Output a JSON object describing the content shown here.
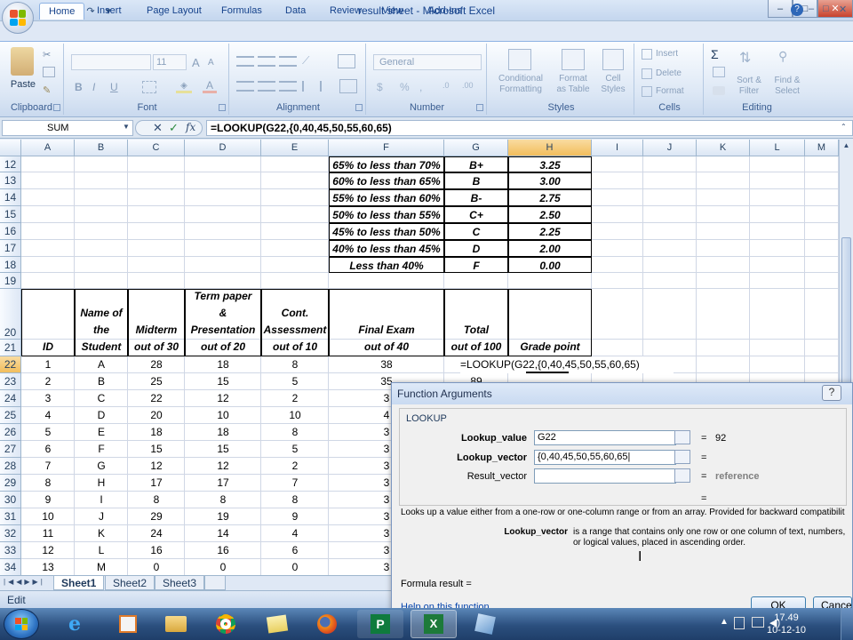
{
  "window": {
    "title": "result sheet - Microsoft Excel",
    "minimize_glyph": "–",
    "maximize_glyph": "□",
    "close_glyph": "✕"
  },
  "ribbon_tabs": [
    "Home",
    "Insert",
    "Page Layout",
    "Formulas",
    "Data",
    "Review",
    "View",
    "Add-Ins"
  ],
  "ribbon_extra": {
    "minimize": "–",
    "restore": "□",
    "close": "✕"
  },
  "ribbon": {
    "clipboard": {
      "label": "Clipboard",
      "paste": "Paste"
    },
    "font": {
      "label": "Font",
      "font_size": "11",
      "grow": "A",
      "shrink": "A",
      "bold": "B",
      "italic": "I",
      "underline": "U"
    },
    "alignment": {
      "label": "Alignment"
    },
    "number": {
      "label": "Number",
      "format": "General"
    },
    "styles": {
      "label": "Styles",
      "conditional": "Conditional\nFormatting",
      "table": "Format\nas Table",
      "cell": "Cell\nStyles"
    },
    "cells": {
      "label": "Cells",
      "insert": "Insert",
      "delete": "Delete",
      "format": "Format"
    },
    "editing": {
      "label": "Editing",
      "sum": "Σ",
      "sort": "Sort &\nFilter",
      "find": "Find &\nSelect"
    }
  },
  "formula_bar": {
    "name_box": "SUM",
    "fx": "fx",
    "cancel": "✕",
    "enter": "✓",
    "formula": "=LOOKUP(G22,{0,40,45,50,55,60,65)"
  },
  "columns": [
    "A",
    "B",
    "C",
    "D",
    "E",
    "F",
    "G",
    "H",
    "I",
    "J",
    "K",
    "L",
    "M"
  ],
  "selected_column": "H",
  "rows": [
    "12",
    "13",
    "14",
    "15",
    "16",
    "17",
    "18",
    "19",
    "20",
    "21",
    "22",
    "23",
    "24",
    "25",
    "26",
    "27",
    "28",
    "29",
    "30",
    "31",
    "32",
    "33",
    "34"
  ],
  "selected_row": "22",
  "grade_table": [
    {
      "range": "65% to less than 70%",
      "grade": "B+",
      "point": "3.25"
    },
    {
      "range": "60% to less than 65%",
      "grade": "B",
      "point": "3.00"
    },
    {
      "range": "55% to less than 60%",
      "grade": "B-",
      "point": "2.75"
    },
    {
      "range": "50% to less than 55%",
      "grade": "C+",
      "point": "2.50"
    },
    {
      "range": "45% to less than 50%",
      "grade": "C",
      "point": "2.25"
    },
    {
      "range": "40% to less than 45%",
      "grade": "D",
      "point": "2.00"
    },
    {
      "range": "Less than 40%",
      "grade": "F",
      "point": "0.00"
    }
  ],
  "headers": {
    "id": "ID",
    "name_l1": "Name of",
    "name_l2": "the",
    "name_l3": "Student",
    "midterm_l1": "Midterm",
    "midterm_l2": "out of 30",
    "term_l1": "Term paper",
    "term_l2": "&",
    "term_l3": "Presentation",
    "term_l4": "out of 20",
    "cont_l1": "Cont.",
    "cont_l2": "Assessment",
    "cont_l3": "out of 10",
    "final_l1": "Final Exam",
    "final_l2": "out of 40",
    "total_l1": "Total",
    "total_l2": "out of 100",
    "grade": "Grade point"
  },
  "students": [
    {
      "id": "1",
      "name": "A",
      "mid": "28",
      "term": "18",
      "cont": "8",
      "final": "38"
    },
    {
      "id": "2",
      "name": "B",
      "mid": "25",
      "term": "15",
      "cont": "5",
      "final": "35"
    },
    {
      "id": "3",
      "name": "C",
      "mid": "22",
      "term": "12",
      "cont": "2",
      "final": "3"
    },
    {
      "id": "4",
      "name": "D",
      "mid": "20",
      "term": "10",
      "cont": "10",
      "final": "4"
    },
    {
      "id": "5",
      "name": "E",
      "mid": "18",
      "term": "18",
      "cont": "8",
      "final": "3"
    },
    {
      "id": "6",
      "name": "F",
      "mid": "15",
      "term": "15",
      "cont": "5",
      "final": "3"
    },
    {
      "id": "7",
      "name": "G",
      "mid": "12",
      "term": "12",
      "cont": "2",
      "final": "3"
    },
    {
      "id": "8",
      "name": "H",
      "mid": "17",
      "term": "17",
      "cont": "7",
      "final": "3"
    },
    {
      "id": "9",
      "name": "I",
      "mid": "8",
      "term": "8",
      "cont": "8",
      "final": "3"
    },
    {
      "id": "10",
      "name": "J",
      "mid": "29",
      "term": "19",
      "cont": "9",
      "final": "3"
    },
    {
      "id": "11",
      "name": "K",
      "mid": "24",
      "term": "14",
      "cont": "4",
      "final": "3"
    },
    {
      "id": "12",
      "name": "L",
      "mid": "16",
      "term": "16",
      "cont": "6",
      "final": "3"
    },
    {
      "id": "13",
      "name": "M",
      "mid": "0",
      "term": "0",
      "cont": "0",
      "final": "3"
    }
  ],
  "editing_cell": "=LOOKUP(G22,{0,40,45,50,55,60,65)",
  "g23_partial": "89",
  "sheets": [
    "Sheet1",
    "Sheet2",
    "Sheet3"
  ],
  "status": "Edit",
  "dialog": {
    "title": "Function Arguments",
    "help": "?",
    "function_name": "LOOKUP",
    "args": [
      {
        "label": "Lookup_value",
        "value": "G22",
        "result": "92",
        "bold": true
      },
      {
        "label": "Lookup_vector",
        "value": "{0,40,45,50,55,60,65|",
        "result": "",
        "bold": true
      },
      {
        "label": "Result_vector",
        "value": "",
        "result": "reference",
        "bold": false
      }
    ],
    "eq": "=",
    "description": "Looks up a value either from a one-row or one-column range or from an array. Provided for backward compatibilit",
    "arg_help_name": "Lookup_vector",
    "arg_help_text": "is a range that contains only one row or one column of text, numbers, or logical values, placed in ascending order.",
    "formula_result": "Formula result =",
    "help_link": "Help on this function",
    "ok": "OK",
    "cancel": "Cancel"
  },
  "taskbar": {
    "time": "17.49",
    "date": "10-12-10"
  },
  "colors": {
    "excel_green": "#1d7a3a",
    "selection": "#f2bd5c",
    "ribbon_blue": "#dfe8f5"
  }
}
